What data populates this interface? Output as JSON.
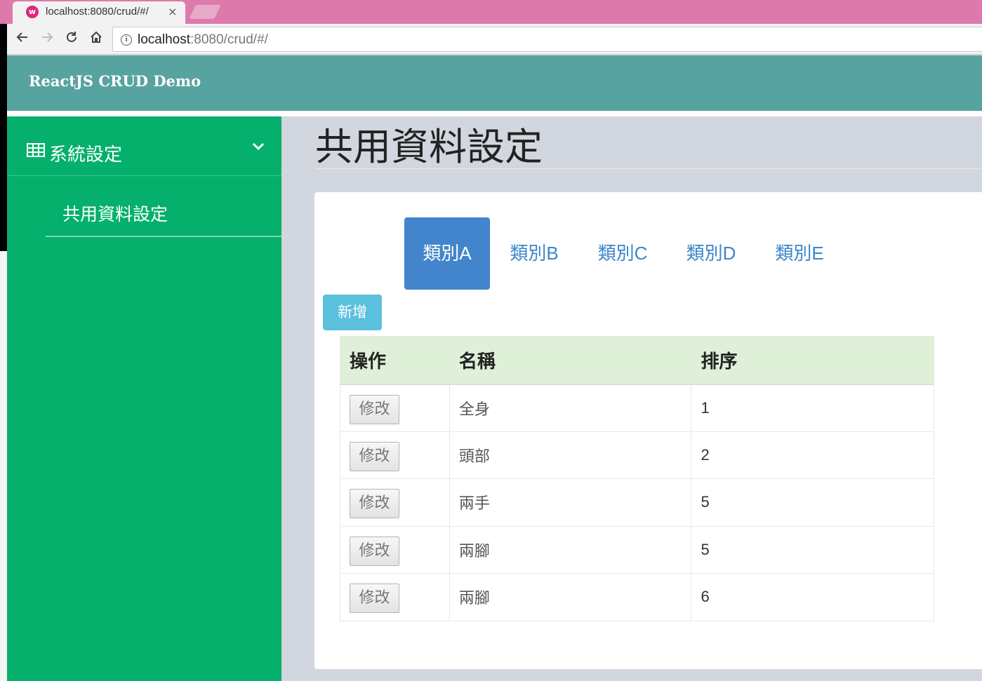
{
  "browser": {
    "tab_title": "localhost:8080/crud/#/",
    "tab_close": "×",
    "favicon": "w",
    "url_host": "localhost",
    "url_rest": ":8080/crud/#/",
    "nav_icons": [
      "back-arrow-icon",
      "forward-arrow-icon",
      "reload-icon",
      "home-icon"
    ]
  },
  "header": {
    "brand": "ReactJS CRUD Demo",
    "color": "#57a3a0"
  },
  "sidebar": {
    "color": "#05b06c",
    "menu_label": "系統設定",
    "menu_icon": "table-grid-icon",
    "submenu_label": "共用資料設定"
  },
  "main": {
    "title": "共用資料設定",
    "tabs": [
      {
        "label": "類別A",
        "active": true
      },
      {
        "label": "類別B",
        "active": false
      },
      {
        "label": "類別C",
        "active": false
      },
      {
        "label": "類別D",
        "active": false
      },
      {
        "label": "類別E",
        "active": false
      }
    ],
    "add_label": "新增",
    "table": {
      "headers": [
        "操作",
        "名稱",
        "排序"
      ],
      "edit_label": "修改",
      "rows": [
        {
          "name": "全身",
          "sort": "1"
        },
        {
          "name": "頭部",
          "sort": "2"
        },
        {
          "name": "兩手",
          "sort": "5"
        },
        {
          "name": "兩腳",
          "sort": "5"
        },
        {
          "name": "兩腳",
          "sort": "6"
        }
      ]
    }
  }
}
